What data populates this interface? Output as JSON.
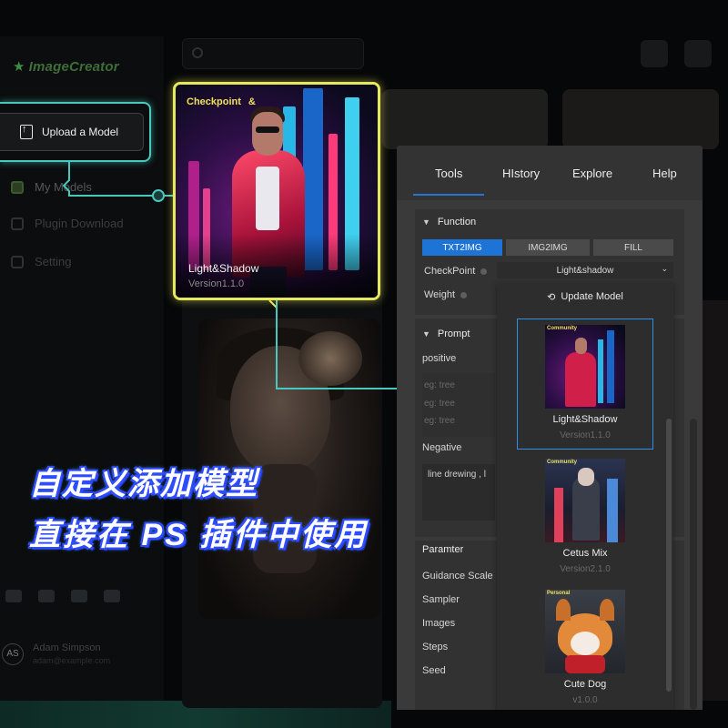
{
  "background": {
    "logo": "ImageCreator",
    "nav": [
      "My Models",
      "Plugin Download",
      "Setting"
    ],
    "user": {
      "initials": "AS",
      "name": "Adam Simpson",
      "email": "adam@example.com"
    }
  },
  "upload_button": {
    "label": "Upload a Model"
  },
  "model_card": {
    "tag": "Checkpoint",
    "tag_symbol": "&",
    "title": "Light&Shadow",
    "version": "Version1.1.0"
  },
  "panel": {
    "tabs": [
      "Tools",
      "HIstory",
      "Explore",
      "Help"
    ],
    "function": {
      "header": "Function",
      "modes": [
        "TXT2IMG",
        "IMG2IMG",
        "FILL"
      ],
      "active_mode": "TXT2IMG",
      "checkpoint_label": "CheckPoint",
      "checkpoint_value": "Light&shadow",
      "weight_label": "Weight"
    },
    "dropdown": {
      "update_label": "Update Model",
      "models": [
        {
          "badge": "Community",
          "name": "Light&Shadow",
          "version": "Version1.1.0"
        },
        {
          "badge": "Community",
          "name": "Cetus Mix",
          "version": "Version2.1.0"
        },
        {
          "badge": "Personal",
          "name": "Cute Dog",
          "version": "v1.0.0"
        }
      ]
    },
    "prompt": {
      "header": "Prompt",
      "positive_label": "positive",
      "positive_placeholders": [
        "eg: tree",
        "eg: tree",
        "eg: tree"
      ],
      "negative_label": "Negative",
      "negative_value": "line drewing , l"
    },
    "parameter": {
      "header": "Paramter",
      "fields": [
        "Guidance Scale",
        "Sampler",
        "Images",
        "Steps",
        "Seed"
      ]
    }
  },
  "overlay": {
    "line1": "自定义添加模型",
    "line2": "直接在 PS 插件中使用"
  },
  "colors": {
    "teal_callout": "#47c9bf",
    "yellow_callout": "#e7e85a",
    "accent_blue": "#1e73d6",
    "selection_blue": "#2f8fe8"
  }
}
